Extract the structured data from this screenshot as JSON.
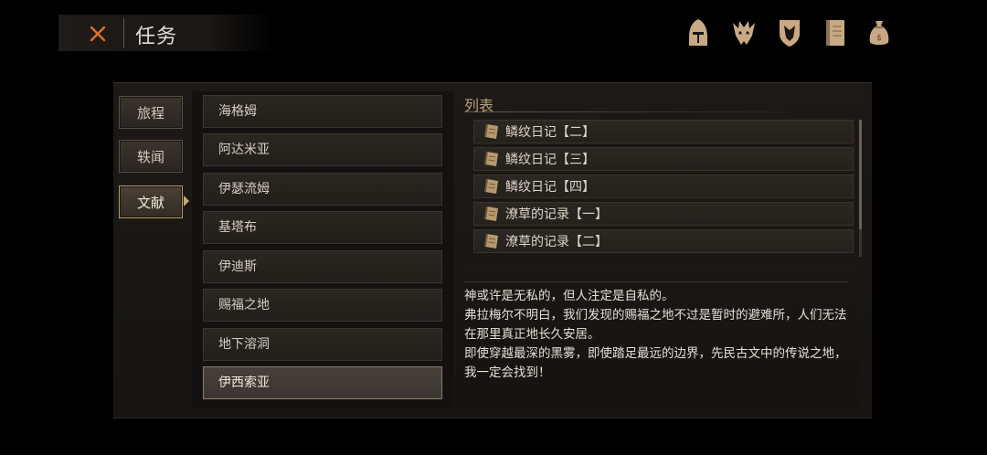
{
  "header": {
    "title": "任务",
    "close_icon": "close-x-icon"
  },
  "top_icons": [
    {
      "name": "knight-helmet-icon"
    },
    {
      "name": "beast-emblem-icon"
    },
    {
      "name": "shield-crest-icon"
    },
    {
      "name": "journal-book-icon"
    },
    {
      "name": "money-bag-icon"
    }
  ],
  "categories": [
    {
      "label": "旅程",
      "active": false
    },
    {
      "label": "轶闻",
      "active": false
    },
    {
      "label": "文献",
      "active": true
    }
  ],
  "regions": [
    {
      "label": "海格姆",
      "selected": false
    },
    {
      "label": "阿达米亚",
      "selected": false
    },
    {
      "label": "伊瑟流姆",
      "selected": false
    },
    {
      "label": "基塔布",
      "selected": false
    },
    {
      "label": "伊迪斯",
      "selected": false
    },
    {
      "label": "赐福之地",
      "selected": false
    },
    {
      "label": "地下溶洞",
      "selected": false
    },
    {
      "label": "伊西索亚",
      "selected": true
    }
  ],
  "list": {
    "title": "列表",
    "entries": [
      {
        "label": "鳞纹日记【二】",
        "icon": "scroll-icon"
      },
      {
        "label": "鳞纹日记【三】",
        "icon": "scroll-icon"
      },
      {
        "label": "鳞纹日记【四】",
        "icon": "scroll-icon"
      },
      {
        "label": "潦草的记录【一】",
        "icon": "scroll-icon"
      },
      {
        "label": "潦草的记录【二】",
        "icon": "scroll-icon"
      }
    ]
  },
  "description": {
    "lines": [
      "神或许是无私的，但人注定是自私的。",
      "弗拉梅尔不明白，我们发现的赐福之地不过是暂时的避难所，人们无法在那里真正地长久安居。",
      "即使穿越最深的黑雾，即使踏足最远的边界，先民古文中的传说之地，我一定会找到！"
    ]
  },
  "colors": {
    "accent_gold": "#c4a877",
    "close_orange": "#e0702a",
    "icon_tan": "#c9a983"
  }
}
